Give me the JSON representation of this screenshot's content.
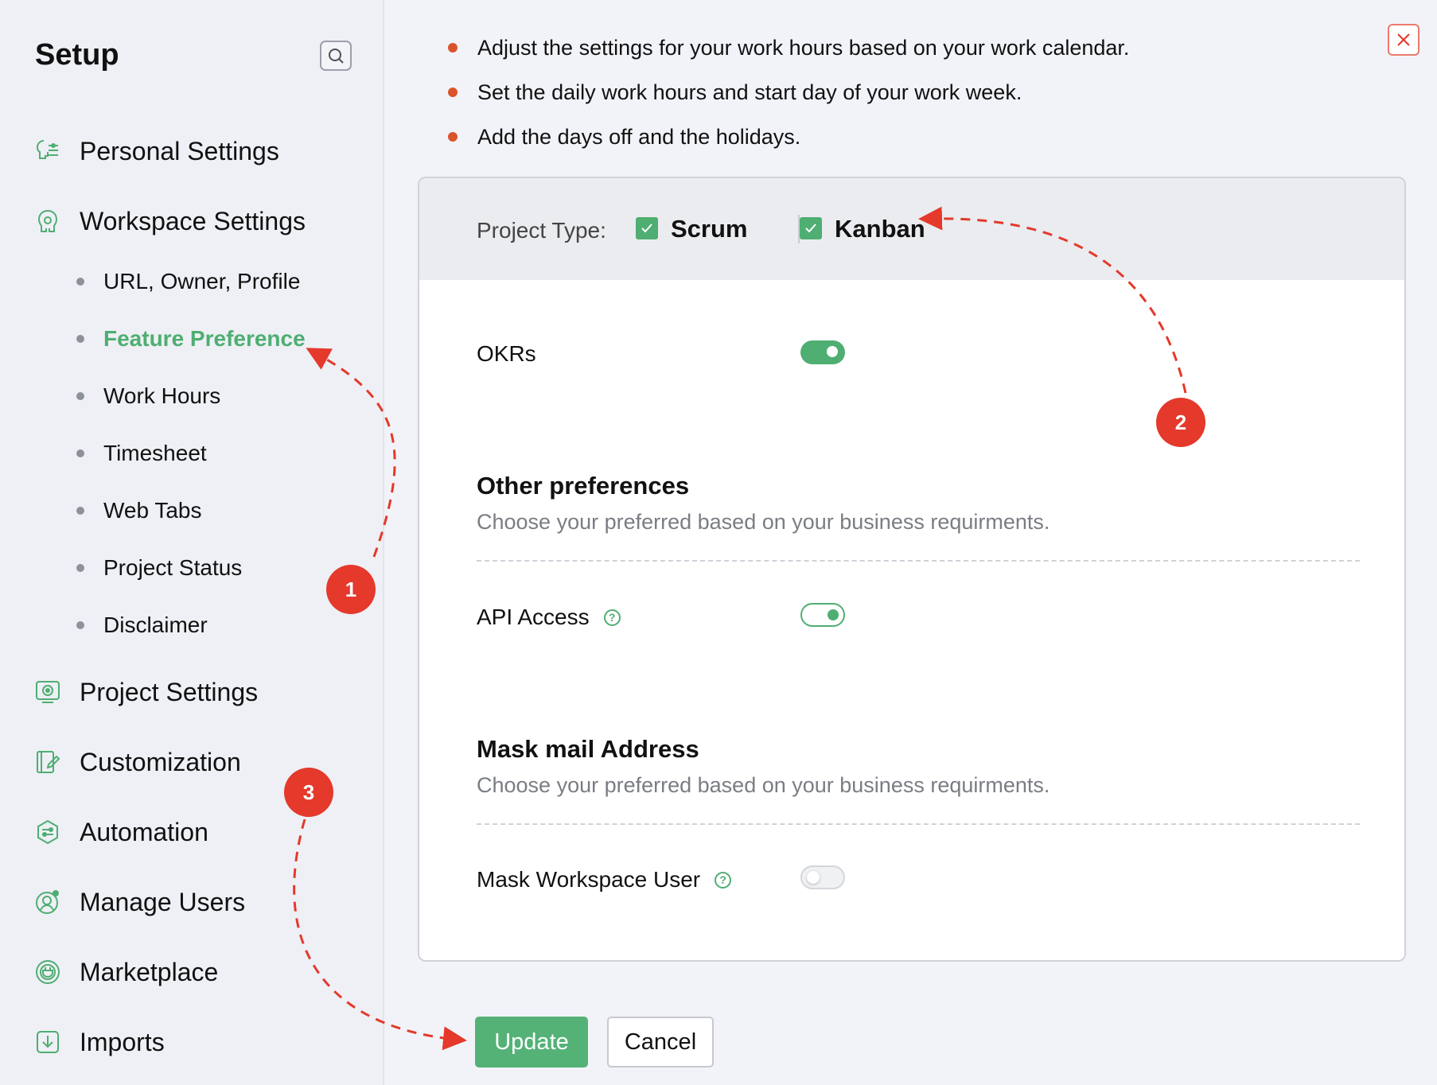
{
  "sidebar": {
    "title": "Setup",
    "main_items": [
      {
        "label": "Personal Settings",
        "icon": "personal-settings-icon"
      },
      {
        "label": "Workspace Settings",
        "icon": "workspace-settings-icon"
      },
      {
        "label": "Project Settings",
        "icon": "project-settings-icon"
      },
      {
        "label": "Customization",
        "icon": "customization-icon"
      },
      {
        "label": "Automation",
        "icon": "automation-icon"
      },
      {
        "label": "Manage Users",
        "icon": "manage-users-icon"
      },
      {
        "label": "Marketplace",
        "icon": "marketplace-icon"
      },
      {
        "label": "Imports",
        "icon": "imports-icon"
      }
    ],
    "sub_items": [
      {
        "label": "URL, Owner, Profile"
      },
      {
        "label": "Feature Preference",
        "active": true
      },
      {
        "label": "Work Hours"
      },
      {
        "label": "Timesheet"
      },
      {
        "label": "Web Tabs"
      },
      {
        "label": "Project Status"
      },
      {
        "label": "Disclaimer"
      }
    ]
  },
  "main": {
    "bullets": [
      "Adjust the settings for your work hours based on your work calendar.",
      "Set the daily work hours and start day of your work week.",
      "Add the days off and the holidays."
    ],
    "project_type": {
      "label": "Project Type:",
      "options": [
        {
          "label": "Scrum",
          "checked": true
        },
        {
          "label": "Kanban",
          "checked": true
        }
      ]
    },
    "okrs": {
      "label": "OKRs",
      "state": "on"
    },
    "other_preferences": {
      "title": "Other preferences",
      "description": "Choose your preferred based on your business requirments.",
      "api_access": {
        "label": "API Access",
        "state": "on"
      }
    },
    "mask_mail": {
      "title": "Mask mail Address",
      "description": "Choose your preferred based on your business requirments.",
      "mask_workspace_user": {
        "label": "Mask Workspace User",
        "state": "off"
      }
    },
    "buttons": {
      "update": "Update",
      "cancel": "Cancel"
    }
  },
  "annotations": {
    "badges": [
      "1",
      "2",
      "3"
    ],
    "color": "#e4392b"
  },
  "colors": {
    "accent": "#4fae72",
    "alert": "#e4392b"
  }
}
